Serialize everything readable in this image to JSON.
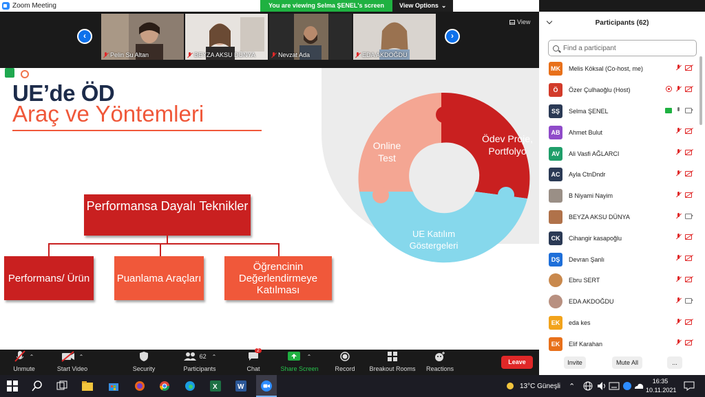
{
  "window": {
    "title": "Zoom Meeting"
  },
  "banner": {
    "viewing": "You are viewing Selma ŞENEL's screen",
    "view_options": "View Options"
  },
  "gallery": {
    "view_label": "View",
    "prev": "‹",
    "next": "›",
    "thumbs": [
      {
        "name": "Pelin Su Altan"
      },
      {
        "name": "BEYZA AKSU DÜNYA"
      },
      {
        "name": "Nevzat Ada"
      },
      {
        "name": "EDA AKDOĞDU"
      }
    ]
  },
  "slide": {
    "title1": "UE’de ÖD",
    "title2": "Araç ve Yöntemleri",
    "main_box": "Performansa Dayalı Teknikler",
    "boxes": [
      "Performans/ Ürün",
      "Puanlama Araçları",
      "Öğrencinin Değerlendirmeye Katılması"
    ],
    "segments": [
      "Online Test",
      "Ödev Proje, Portfolyo",
      "UE Katılım Göstergeleri"
    ]
  },
  "toolbar": {
    "unmute": "Unmute",
    "start_video": "Start Video",
    "security": "Security",
    "participants": "Participants",
    "participants_count": "62",
    "chat": "Chat",
    "chat_badge": "2",
    "share_screen": "Share Screen",
    "record": "Record",
    "breakout": "Breakout Rooms",
    "reactions": "Reactions",
    "leave": "Leave"
  },
  "panel": {
    "title": "Participants (62)",
    "search_placeholder": "Find a participant",
    "invite": "Invite",
    "mute_all": "Mute All",
    "more": "...",
    "participants": [
      {
        "initials": "MK",
        "name": "Melis Köksal (Co-host, me)",
        "color": "#e8701a"
      },
      {
        "initials": "Ö",
        "name": "Özer Çulhaoğlu (Host)",
        "color": "#d23b2a"
      },
      {
        "initials": "SŞ",
        "name": "Selma ŞENEL",
        "color": "#2b3a55"
      },
      {
        "initials": "AB",
        "name": "Ahmet Bulut",
        "color": "#8f4bc9"
      },
      {
        "initials": "AV",
        "name": "Ali Vasfi AĞLARCI",
        "color": "#1f9e6a"
      },
      {
        "initials": "AC",
        "name": "Ayla CtnDndr",
        "color": "#2b3a55"
      },
      {
        "initials": "",
        "name": "B Niyami Nayim",
        "color": "#9a8f86"
      },
      {
        "initials": "",
        "name": "BEYZA AKSU DÜNYA",
        "color": "#b0724a"
      },
      {
        "initials": "CK",
        "name": "Cihangir kasapoğlu",
        "color": "#2b3a55"
      },
      {
        "initials": "DŞ",
        "name": "Devran Şanlı",
        "color": "#1e6fd9"
      },
      {
        "initials": "",
        "name": "Ebru SERT",
        "color": "#c9894d"
      },
      {
        "initials": "",
        "name": "EDA AKDOĞDU",
        "color": "#b89080"
      },
      {
        "initials": "EK",
        "name": "eda kes",
        "color": "#f2a31b"
      },
      {
        "initials": "EK",
        "name": "Elif Karahan",
        "color": "#e8701a"
      }
    ]
  },
  "taskbar": {
    "weather": "13°C Güneşli",
    "time": "16:35",
    "date": "10.11.2021"
  }
}
